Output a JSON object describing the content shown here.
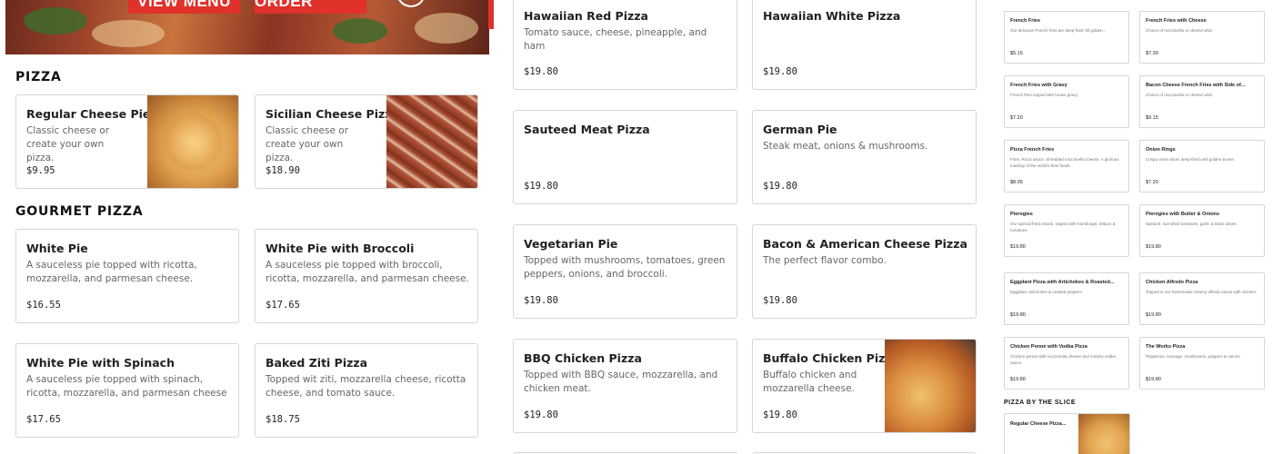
{
  "hero": {
    "view_menu": "VIEW MENU",
    "start_order": "START ORDER"
  },
  "sections": {
    "pizza": "PIZZA",
    "gourmet": "GOURMET PIZZA"
  },
  "pizza": [
    {
      "name": "Regular Cheese Pie",
      "desc": "Classic cheese or create your own pizza.",
      "price": "$9.95"
    },
    {
      "name": "Sicilian Cheese Pizza",
      "desc": "Classic cheese or create your own pizza.",
      "price": "$18.90"
    }
  ],
  "gourmet": [
    {
      "name": "White Pie",
      "desc": "A sauceless pie topped with ricotta, mozzarella, and parmesan cheese.",
      "price": "$16.55"
    },
    {
      "name": "White Pie with Broccoli",
      "desc": "A sauceless pie topped with broccoli, ricotta, mozzarella, and parmesan cheese.",
      "price": "$17.65"
    },
    {
      "name": "White Pie with Spinach",
      "desc": "A sauceless pie topped with spinach, ricotta, mozzarella, and parmesan cheese",
      "price": "$17.65"
    },
    {
      "name": "Baked Ziti Pizza",
      "desc": "Topped wit ziti, mozzarella cheese, ricotta cheese, and tomato sauce.",
      "price": "$18.75"
    }
  ],
  "middle": [
    {
      "name": "Hawaiian Red Pizza",
      "desc": "Tomato sauce, cheese, pineapple, and ham",
      "price": "$19.80"
    },
    {
      "name": "Hawaiian White Pizza",
      "desc": "",
      "price": "$19.80"
    },
    {
      "name": "Sauteed Meat Pizza",
      "desc": "",
      "price": "$19.80"
    },
    {
      "name": "German Pie",
      "desc": "Steak meat, onions & mushrooms.",
      "price": "$19.80"
    },
    {
      "name": "Vegetarian Pie",
      "desc": "Topped with mushrooms, tomatoes, green peppers, onions, and broccoli.",
      "price": "$19.80"
    },
    {
      "name": "Bacon & American Cheese Pizza",
      "desc": "The perfect flavor combo.",
      "price": "$19.80"
    },
    {
      "name": "BBQ Chicken Pizza",
      "desc": "Topped with BBQ sauce, mozzarella, and chicken meat.",
      "price": "$19.80"
    },
    {
      "name": "Buffalo Chicken Pizza",
      "desc": "Buffalo chicken and mozzarella cheese.",
      "price": "$19.80"
    }
  ],
  "right_panel": {
    "items": [
      {
        "name": "French Fries",
        "desc": "Our delicious French fries are deep-fried 'till golden...",
        "price": "$5.15"
      },
      {
        "name": "French Fries with Cheese",
        "desc": "Choice of mozzarella or cheese whiz.",
        "price": "$7.30"
      },
      {
        "name": "French Fries with Gravy",
        "desc": "French fries topped with brown gravy.",
        "price": "$7.20"
      },
      {
        "name": "Bacon Cheese French Fries with Side of...",
        "desc": "Choice of mozzarella or cheese whiz.",
        "price": "$9.15"
      },
      {
        "name": "Pizza French Fries",
        "desc": "Fries. Pizza sauce. Shredded mozzarella cheese. A glorious mashup of the world's best foods.",
        "price": "$8.05"
      },
      {
        "name": "Onion Rings",
        "desc": "Crispy onion slices deep-fried until golden-brown.",
        "price": "$7.20"
      },
      {
        "name": "Pierogies",
        "desc": "Our special fried onions, topped with hamburger, lettuce & tomatoes.",
        "price": "$19.80"
      },
      {
        "name": "Pierogies with Butter & Onions",
        "desc": "Spinach, sun-dried tomatoes, garlic & black olives.",
        "price": "$19.80"
      },
      {
        "name": "Eggplant Pizza with Artichokes & Roasted...",
        "desc": "Eggplant, artichokes & roasted peppers.",
        "price": "$19.80"
      },
      {
        "name": "Chicken Alfredo Pizza",
        "desc": "Topped in our homemade creamy alfredo sauce with chicken.",
        "price": "$19.80"
      },
      {
        "name": "Chicken Penne with Vodka Pizza",
        "desc": "Chicken penne with mozzarella cheese and creamy vodka sauce.",
        "price": "$19.80"
      },
      {
        "name": "The Works Pizza",
        "desc": "Pepperoni, sausage, mushrooms, peppers & onions.",
        "price": "$19.80"
      }
    ],
    "slice_title": "PIZZA BY THE SLICE",
    "slice_item": {
      "name": "Regular Cheese Pizza..."
    }
  }
}
